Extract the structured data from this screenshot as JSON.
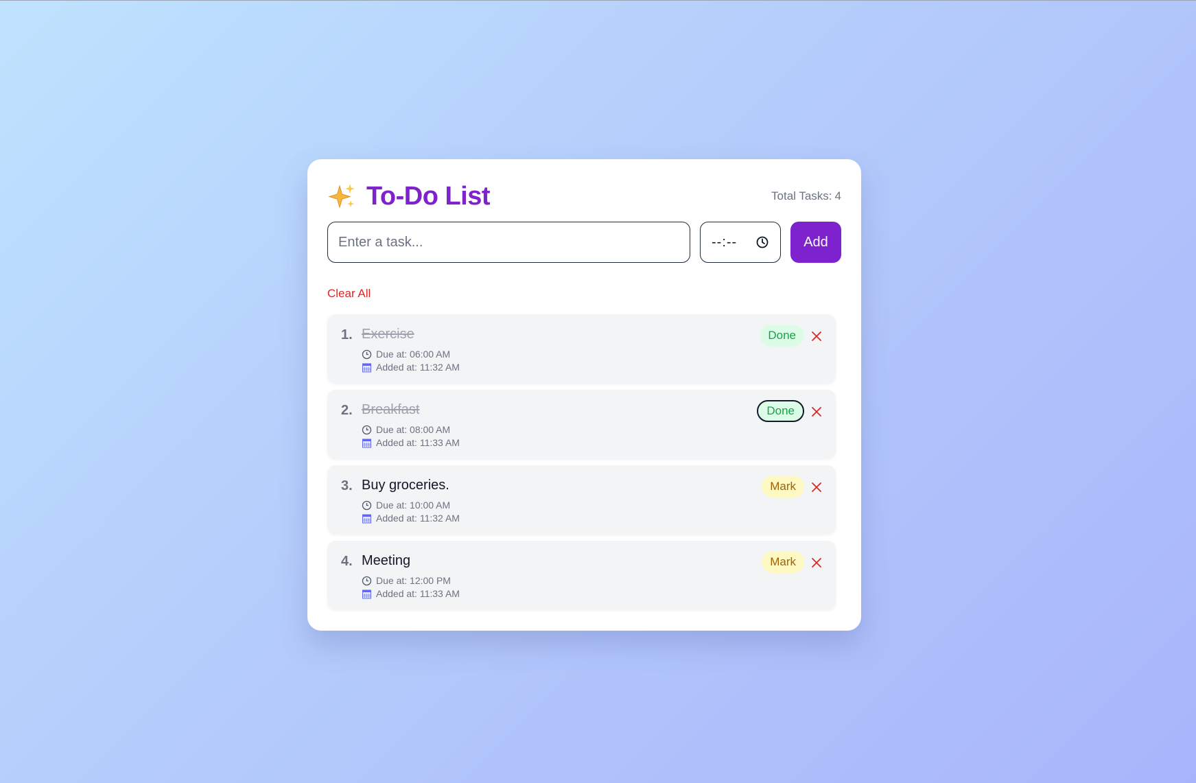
{
  "header": {
    "title": "To-Do List",
    "total_label": "Total Tasks:",
    "total_count": "4",
    "icon": "sparkles-icon"
  },
  "form": {
    "task_placeholder": "Enter a task...",
    "time_value": "--:--",
    "add_label": "Add"
  },
  "clear_all_label": "Clear All",
  "tasks": [
    {
      "num": "1.",
      "text": "Exercise",
      "due": "Due at: 06:00 AM",
      "added": "Added at: 11:32 AM",
      "status": "Done",
      "completed": true
    },
    {
      "num": "2.",
      "text": "Breakfast",
      "due": "Due at: 08:00 AM",
      "added": "Added at: 11:33 AM",
      "status": "Done",
      "completed": true
    },
    {
      "num": "3.",
      "text": "Buy groceries.",
      "due": "Due at: 10:00 AM",
      "added": "Added at: 11:32 AM",
      "status": "Mark",
      "completed": false
    },
    {
      "num": "4.",
      "text": "Meeting",
      "due": "Due at: 12:00 PM",
      "added": "Added at: 11:33 AM",
      "status": "Mark",
      "completed": false
    }
  ],
  "colors": {
    "accent": "#7e22ce",
    "danger": "#dc2626",
    "done_bg": "#dcfce7",
    "done_text": "#16a34a",
    "mark_bg": "#fef9c3",
    "mark_text": "#a16207"
  }
}
